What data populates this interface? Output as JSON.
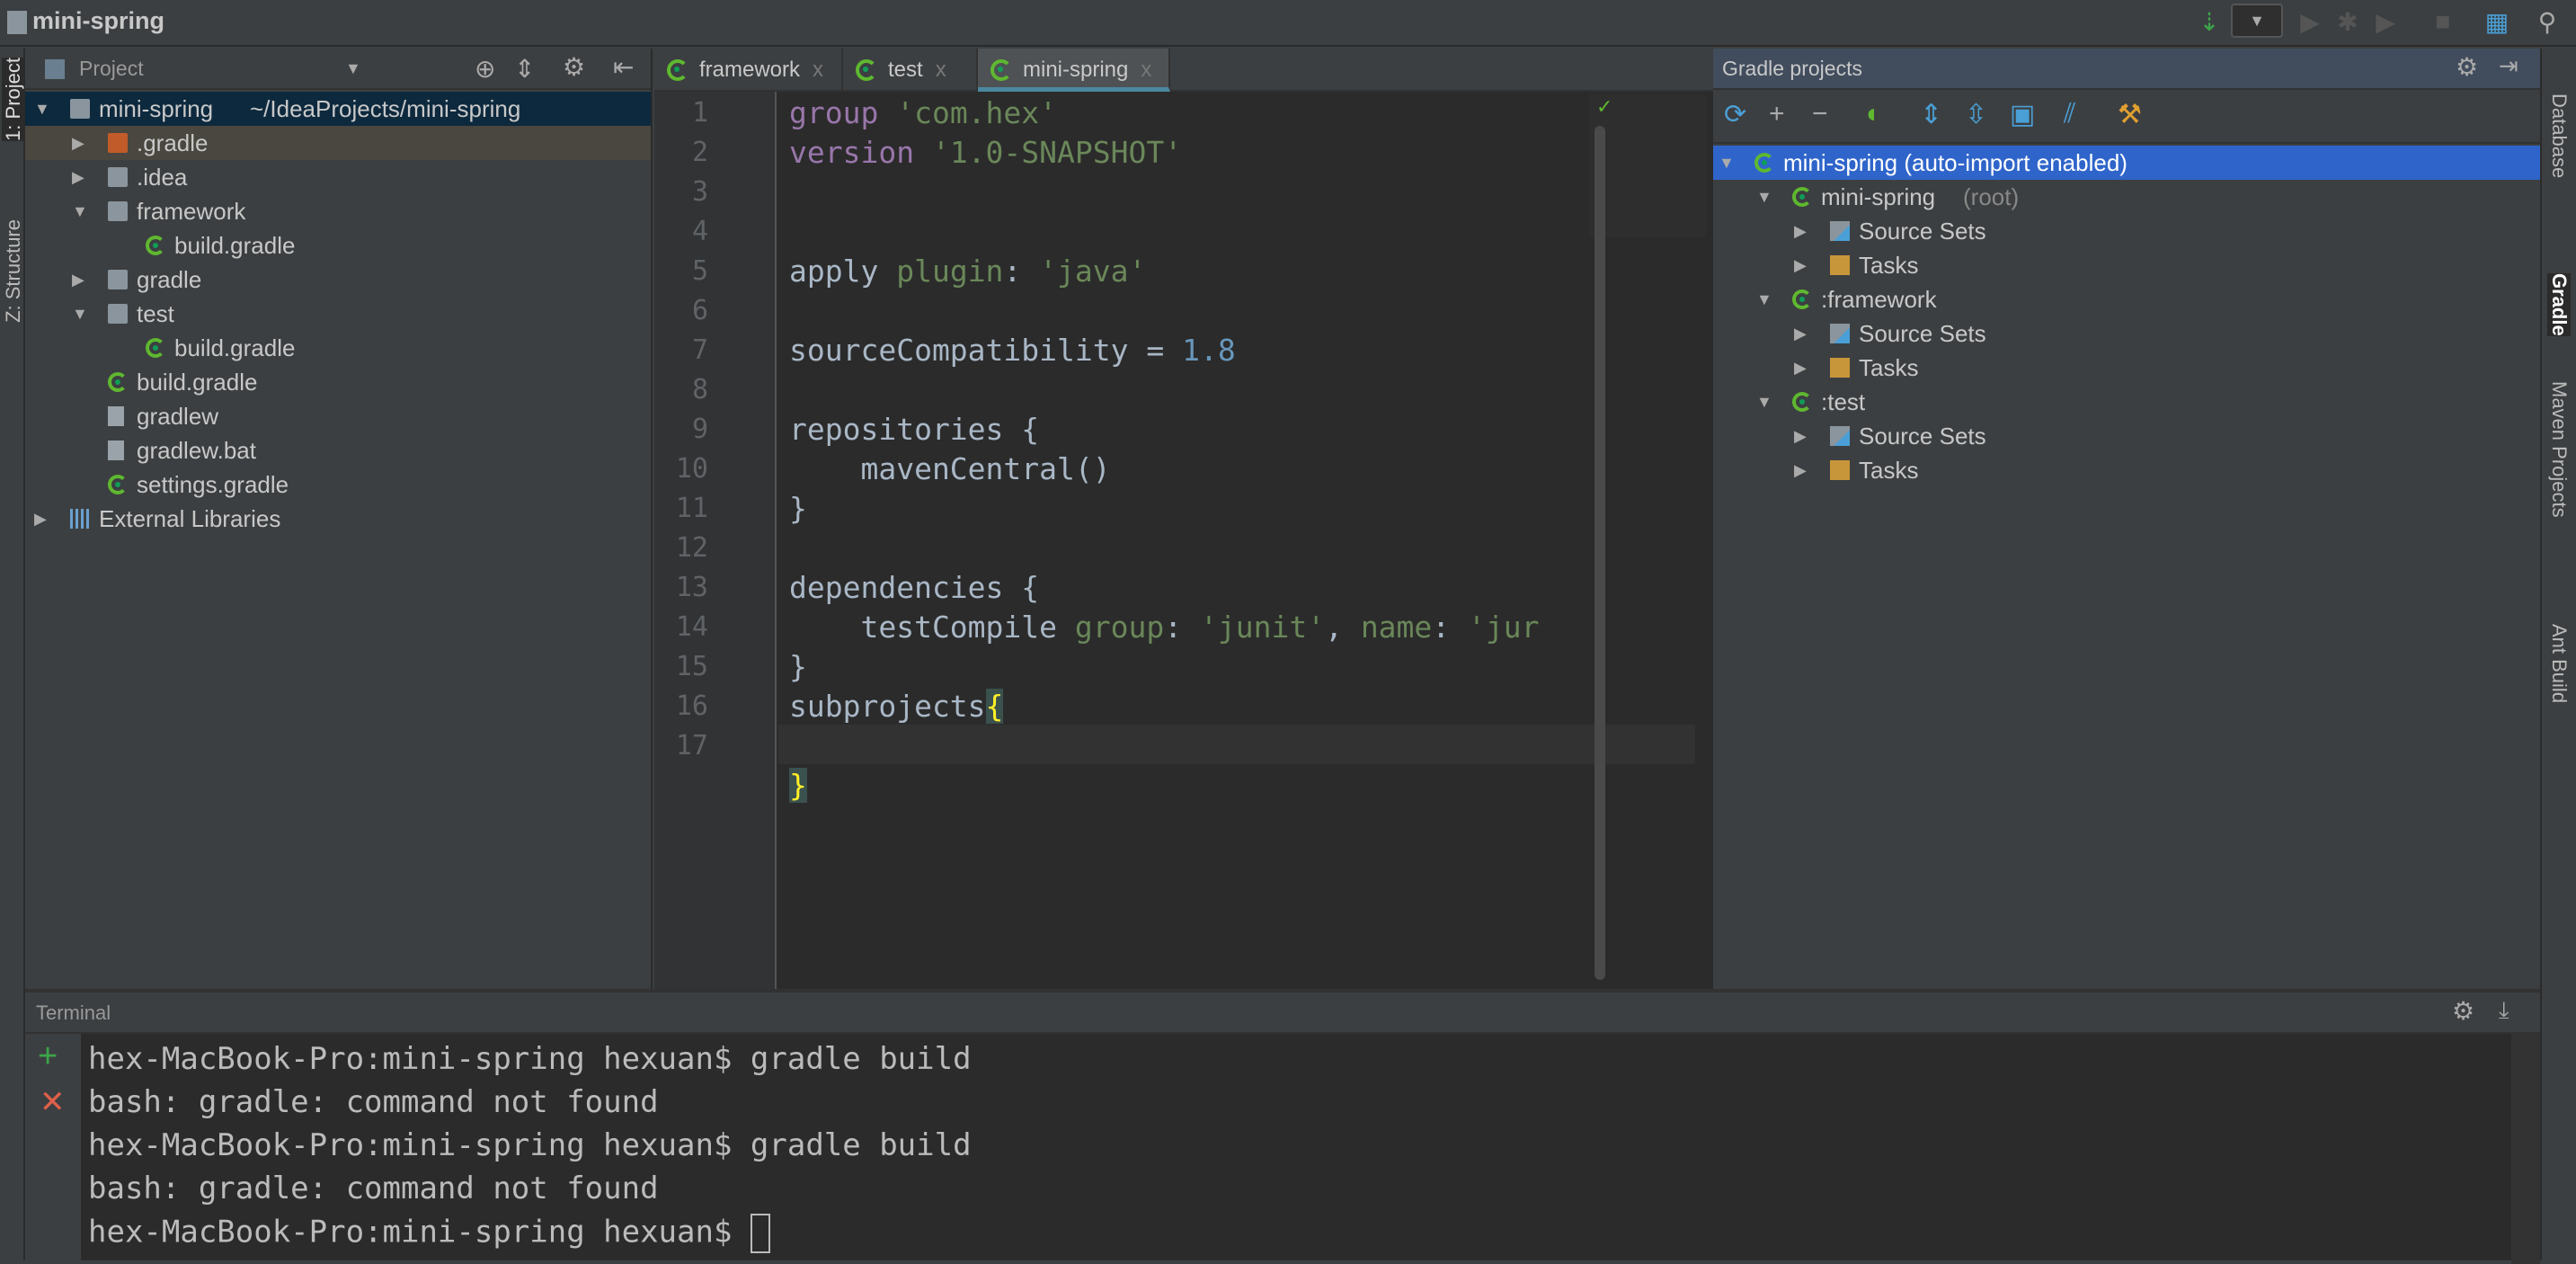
{
  "title": {
    "project": "mini-spring"
  },
  "left_stripe": {
    "project": "1: Project",
    "structure": "Z: Structure"
  },
  "right_stripe": {
    "database": "Database",
    "gradle": "Gradle",
    "maven": "Maven Projects",
    "ant": "Ant Build"
  },
  "project_panel": {
    "title": "Project",
    "tree": [
      {
        "label": "mini-spring",
        "path": "~/IdeaProjects/mini-spring",
        "depth": 0,
        "expanded": true,
        "icon": "module-folder",
        "selected": true
      },
      {
        "label": ".gradle",
        "depth": 1,
        "expanded": false,
        "icon": "folder-excluded"
      },
      {
        "label": ".idea",
        "depth": 1,
        "expanded": false,
        "icon": "folder"
      },
      {
        "label": "framework",
        "depth": 1,
        "expanded": true,
        "icon": "module-folder"
      },
      {
        "label": "build.gradle",
        "depth": 2,
        "icon": "gradle"
      },
      {
        "label": "gradle",
        "depth": 1,
        "expanded": false,
        "icon": "folder"
      },
      {
        "label": "test",
        "depth": 1,
        "expanded": true,
        "icon": "module-folder"
      },
      {
        "label": "build.gradle",
        "depth": 2,
        "icon": "gradle"
      },
      {
        "label": "build.gradle",
        "depth": 1,
        "icon": "gradle"
      },
      {
        "label": "gradlew",
        "depth": 1,
        "icon": "file"
      },
      {
        "label": "gradlew.bat",
        "depth": 1,
        "icon": "file"
      },
      {
        "label": "settings.gradle",
        "depth": 1,
        "icon": "gradle"
      },
      {
        "label": "External Libraries",
        "depth": 0,
        "expanded": false,
        "icon": "libraries"
      }
    ]
  },
  "editor": {
    "tabs": [
      {
        "label": "framework",
        "active": false
      },
      {
        "label": "test",
        "active": false
      },
      {
        "label": "mini-spring",
        "active": true
      }
    ],
    "lines": [
      "1",
      "2",
      "3",
      "4",
      "5",
      "6",
      "7",
      "8",
      "9",
      "10",
      "11",
      "12",
      "13",
      "14",
      "15",
      "16",
      "17"
    ],
    "code": {
      "l1a": "group",
      "l1b": " 'com.hex'",
      "l2a": "version",
      "l2b": " '1.0-SNAPSHOT'",
      "l4a": "apply ",
      "l4b": "plugin",
      ": ": ": ",
      "l4c": "'java'",
      "l6a": "sourceCompatibility = ",
      "l6b": "1.8",
      "l8": "repositories {",
      "l9": "    mavenCentral()",
      "l10": "}",
      "l12": "dependencies {",
      "l13a": "    testCompile ",
      "l13b": "group",
      "l13c": ": ",
      "l13d": "'junit'",
      "l13e": ", ",
      "l13f": "name",
      "l13g": ": ",
      "l13h": "'jur",
      "l14": "}",
      "l15a": "subprojects",
      "l15b": "{",
      "l17": "}"
    }
  },
  "gradle_panel": {
    "title": "Gradle projects",
    "tree": [
      {
        "label": "mini-spring (auto-import enabled)",
        "depth": 0,
        "selected": true,
        "icon": "gradle"
      },
      {
        "label": "mini-spring",
        "suffix": "(root)",
        "depth": 1,
        "icon": "gradle"
      },
      {
        "label": "Source Sets",
        "depth": 2,
        "icon": "source-sets"
      },
      {
        "label": "Tasks",
        "depth": 2,
        "icon": "tasks-folder"
      },
      {
        "label": ":framework",
        "depth": 1,
        "icon": "gradle"
      },
      {
        "label": "Source Sets",
        "depth": 2,
        "icon": "source-sets"
      },
      {
        "label": "Tasks",
        "depth": 2,
        "icon": "tasks-folder"
      },
      {
        "label": ":test",
        "depth": 1,
        "icon": "gradle"
      },
      {
        "label": "Source Sets",
        "depth": 2,
        "icon": "source-sets"
      },
      {
        "label": "Tasks",
        "depth": 2,
        "icon": "tasks-folder"
      }
    ]
  },
  "terminal": {
    "title": "Terminal",
    "lines": [
      "hex-MacBook-Pro:mini-spring hexuan$ gradle build",
      "bash: gradle: command not found",
      "hex-MacBook-Pro:mini-spring hexuan$ gradle build",
      "bash: gradle: command not found",
      "hex-MacBook-Pro:mini-spring hexuan$ "
    ]
  },
  "colors": {
    "selection": "#2f65ca",
    "project_selection": "#0d293e",
    "keyword": "#9876aa",
    "string": "#6a8759",
    "number": "#6897bb",
    "brace_highlight": "#ffef28"
  }
}
